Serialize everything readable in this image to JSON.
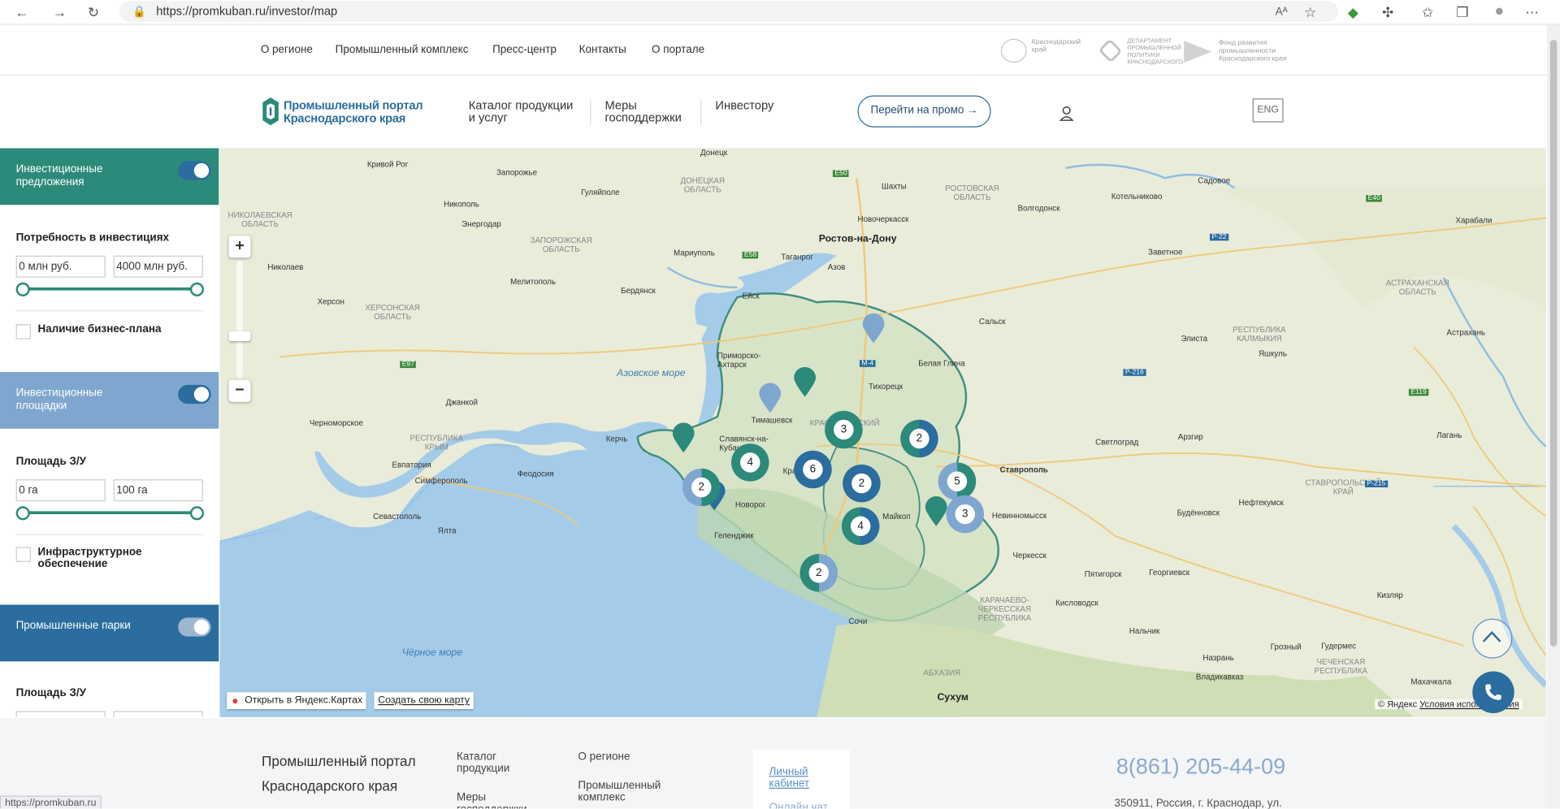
{
  "browser": {
    "url": "https://promkuban.ru/investor/map",
    "status_url": "https://promkuban.ru"
  },
  "topnav": {
    "items": [
      "О регионе",
      "Промышленный комплекс",
      "Пресс-центр",
      "Контакты",
      "О портале"
    ],
    "partners": [
      "Краснодарский\nкрай",
      "ДЕПАРТАМЕНТ\nПРОМЫШЛЕННОЙ\nПОЛИТИКИ\nКРАСНОДАРСКОГО",
      "Фонд развития\nпромышленности\nКраснодарского края"
    ]
  },
  "header": {
    "logo_line1": "Промышленный портал",
    "logo_line2": "Краснодарского края",
    "nav": [
      "Каталог продукции\nи услуг",
      "Меры\nгосподдержки",
      "Инвестору"
    ],
    "promo_button": "Перейти на промо →",
    "lang_button": "ENG"
  },
  "sidebar": {
    "sections": [
      {
        "title": "Инвестиционные предложения",
        "color": "#2b8a7a"
      },
      {
        "title": "Инвестиционные площадки",
        "color": "#7fa6cf"
      },
      {
        "title": "Промышленные парки",
        "color": "#2a6d9e"
      }
    ],
    "invest_need_title": "Потребность в инвестициях",
    "invest_min": "0 млн руб.",
    "invest_max": "4000 млн руб.",
    "business_plan_label": "Наличие бизнес-плана",
    "area_title": "Площадь З/У",
    "area_min": "0 га",
    "area_max": "100 га",
    "infrastructure_label": "Инфраструктурное обеспечение",
    "parks_area_title": "Площадь З/У"
  },
  "map": {
    "zoom_in": "+",
    "zoom_out": "−",
    "open_yandex": "Открыть в Яндекс.Картах",
    "create_map": "Создать свою карту",
    "copyright": "© Яндекс",
    "terms": "Условия использования",
    "cities_big": [
      "Ростов-на-Дону",
      "Сухум"
    ],
    "cities": [
      "Донецк",
      "Кривой Рог",
      "Запорожье",
      "Гуляйполе",
      "Никополь",
      "Энергодар",
      "Мариуполь",
      "Таганрог",
      "Азов",
      "Шахты",
      "Новочеркасск",
      "Волгодонск",
      "Котельниково",
      "Садовое",
      "Харабали",
      "Заветное",
      "Николаев",
      "Херсон",
      "Мелитополь",
      "Бердянск",
      "Ейск",
      "Сальск",
      "Элиста",
      "Яшкуль",
      "Астрахань",
      "Джанкой",
      "Черноморское",
      "Керчь",
      "Евпатория",
      "Симферополь",
      "Феодосия",
      "Севастополь",
      "Ялта",
      "Приморско-Ахтарск",
      "Тимашевск",
      "Тихорецк",
      "Белая Глина",
      "Славянск-на-Кубани",
      "Краснодар",
      "Новороссийск",
      "Геленджик",
      "Майкоп",
      "Сочи",
      "Ставрополь",
      "Светлоград",
      "Арзгир",
      "Невинномысск",
      "Нефтекумск",
      "Будённовск",
      "Черкесск",
      "Пятигорск",
      "Георгиевск",
      "Кисловодск",
      "Нальчик",
      "Кизляр",
      "Назрань",
      "Грозный",
      "Гудермес",
      "Владикавказ",
      "Махачкала",
      "Лагань"
    ],
    "regions": [
      "НИКОЛАЕВСКАЯ\nОБЛАСТЬ",
      "ХЕРСОНСКАЯ\nОБЛАСТЬ",
      "ЗАПОРОЖСКАЯ\nОБЛАСТЬ",
      "ДОНЕЦКАЯ\nОБЛАСТЬ",
      "РОСТОВСКАЯ\nОБЛАСТЬ",
      "АСТРАХАНСКАЯ\nОБЛАСТЬ",
      "РЕСПУБЛИКА\nКАЛМЫКИЯ",
      "РЕСПУБЛИКА\nКРЫМ",
      "СТАВРОПОЛЬСКИЙ\nКРАЙ",
      "КАРАЧАЕВО-\nЧЕРКЕССКАЯ\nРЕСПУБЛИКА",
      "ЧЕЧЕНСКАЯ\nРЕСПУБЛИКА",
      "АБХАЗИЯ",
      "КРАСНОДАРСКИЙ"
    ],
    "seas": [
      "Азовское море",
      "Чёрное море"
    ],
    "roads": [
      "E50",
      "E58",
      "M-4",
      "E40",
      "P-22",
      "P-216",
      "E97",
      "E119",
      "P-215"
    ],
    "clusters": [
      {
        "count": "3",
        "colors": [
          "#2b8a7a",
          "#2b8a7a"
        ]
      },
      {
        "count": "2",
        "colors": [
          "#2a6d9e",
          "#2b8a7a"
        ]
      },
      {
        "count": "4",
        "colors": [
          "#2b8a7a",
          "#2b8a7a"
        ]
      },
      {
        "count": "6",
        "colors": [
          "#2a6d9e",
          "#2a6d9e"
        ]
      },
      {
        "count": "2",
        "colors": [
          "#2a6d9e",
          "#2a6d9e"
        ]
      },
      {
        "count": "5",
        "colors": [
          "#2b8a7a",
          "#7fa6cf"
        ]
      },
      {
        "count": "2",
        "colors": [
          "#2b8a7a",
          "#7fa6cf"
        ]
      },
      {
        "count": "4",
        "colors": [
          "#2a6d9e",
          "#2b8a7a"
        ]
      },
      {
        "count": "3",
        "colors": [
          "#7fa6cf",
          "#7fa6cf"
        ]
      },
      {
        "count": "2",
        "colors": [
          "#7fa6cf",
          "#2b8a7a"
        ]
      }
    ]
  },
  "footer": {
    "logo_line1": "Промышленный портал",
    "logo_line2": "Краснодарского края",
    "col1": [
      "Каталог\nпродукции",
      "Меры\nгосподдержки"
    ],
    "col2": [
      "О регионе",
      "Промышленный\nкомплекс"
    ],
    "cabinet": "Личный\nкабинет",
    "online_chat": "Онлайн чат",
    "phone": "8(861) 205-44-09",
    "address": "350911, Россия, г. Краснодар, ул."
  }
}
